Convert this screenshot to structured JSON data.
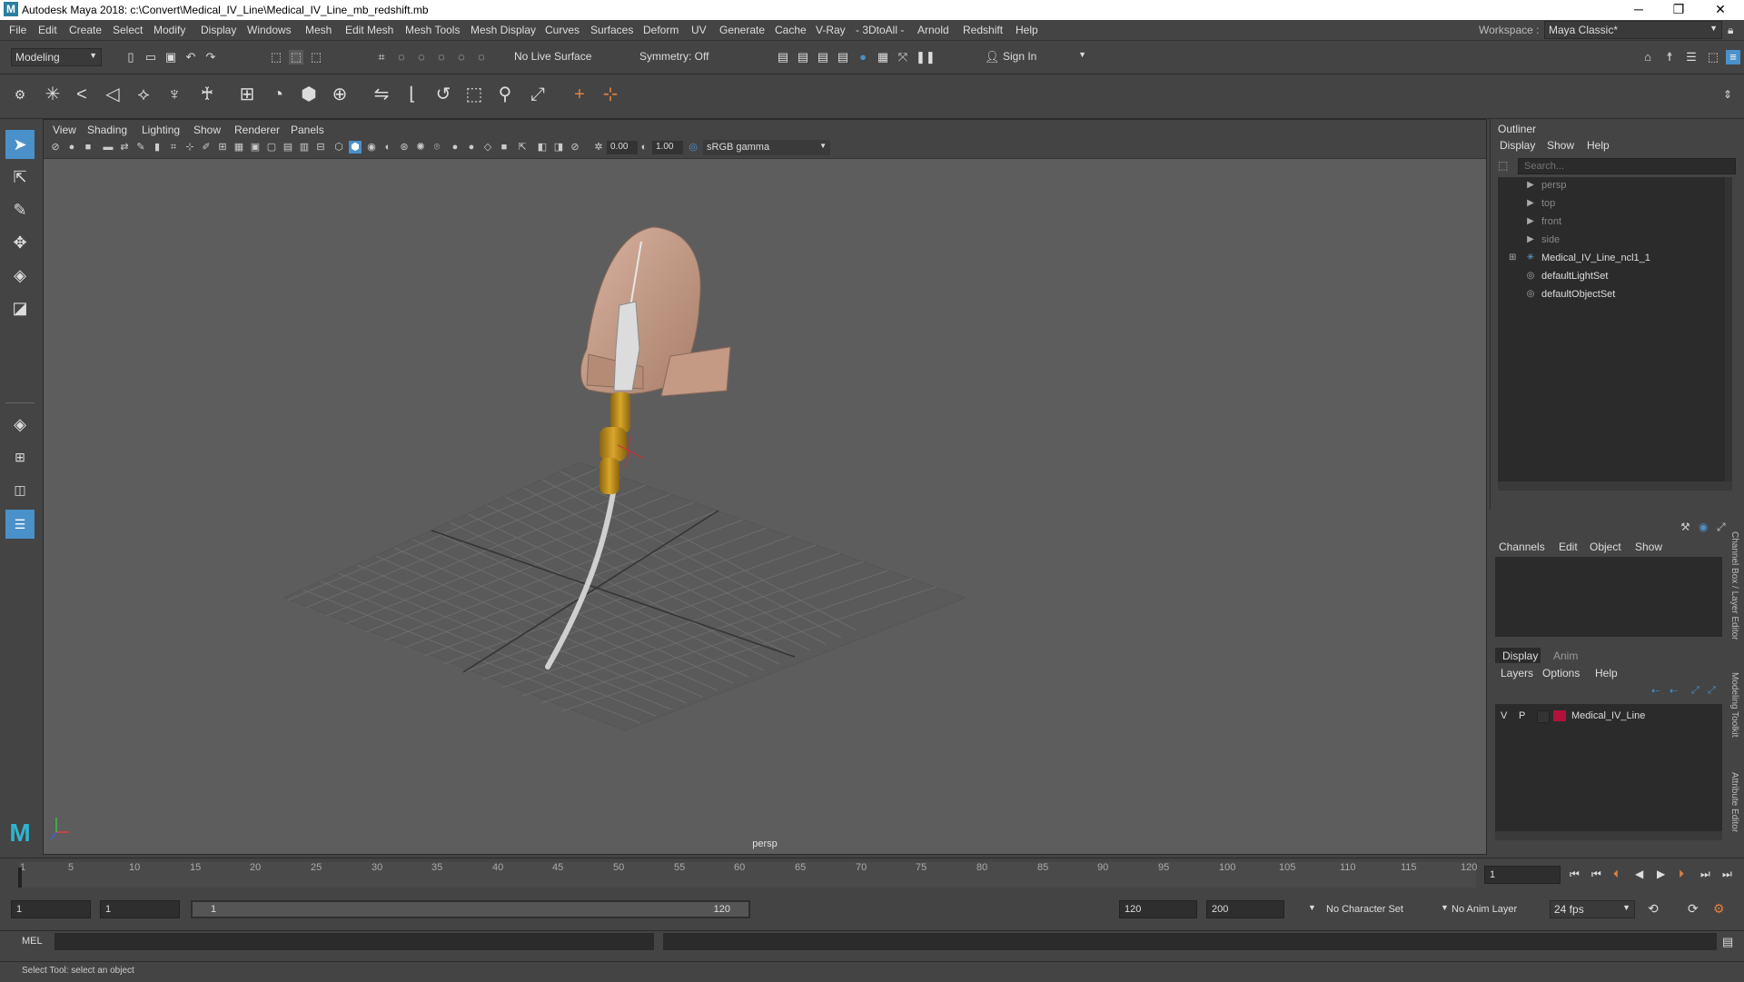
{
  "window": {
    "title": "Autodesk Maya 2018: c:\\Convert\\Medical_IV_Line\\Medical_IV_Line_mb_redshift.mb",
    "minimize": "─",
    "maximize": "❐",
    "close": "✕"
  },
  "menubar": {
    "items": [
      "File",
      "Edit",
      "Create",
      "Select",
      "Modify",
      "Display",
      "Windows",
      "Mesh",
      "Edit Mesh",
      "Mesh Tools",
      "Mesh Display",
      "Curves",
      "Surfaces",
      "Deform",
      "UV",
      "Generate",
      "Cache",
      "V-Ray",
      "- 3DtoAll -",
      "Arnold",
      "Redshift",
      "Help"
    ],
    "workspace_label": "Workspace :",
    "workspace_value": "Maya Classic*"
  },
  "statusline": {
    "mode": "Modeling",
    "live_surface": "No Live Surface",
    "symmetry": "Symmetry: Off",
    "sign_in": "Sign In"
  },
  "viewport": {
    "menus": [
      "View",
      "Shading",
      "Lighting",
      "Show",
      "Renderer",
      "Panels"
    ],
    "exposure": "0.00",
    "gamma": "1.00",
    "color_space": "sRGB gamma",
    "camera_label": "persp"
  },
  "outliner": {
    "title": "Outliner",
    "menus": [
      "Display",
      "Show",
      "Help"
    ],
    "search_placeholder": "Search...",
    "items": [
      {
        "label": "persp",
        "icon": "camera-icon",
        "dim": true
      },
      {
        "label": "top",
        "icon": "camera-icon",
        "dim": true
      },
      {
        "label": "front",
        "icon": "camera-icon",
        "dim": true
      },
      {
        "label": "side",
        "icon": "camera-icon",
        "dim": true
      },
      {
        "label": "Medical_IV_Line_ncl1_1",
        "icon": "group-icon",
        "dim": false
      },
      {
        "label": "defaultLightSet",
        "icon": "set-icon",
        "dim": false
      },
      {
        "label": "defaultObjectSet",
        "icon": "set-icon",
        "dim": false
      }
    ]
  },
  "channelbox": {
    "menus": [
      "Channels",
      "Edit",
      "Object",
      "Show"
    ]
  },
  "layers": {
    "tabs": [
      "Display",
      "Anim"
    ],
    "menus": [
      "Layers",
      "Options",
      "Help"
    ],
    "layer": {
      "v": "V",
      "p": "P",
      "name": "Medical_IV_Line",
      "color": "#b0123a"
    }
  },
  "side_tabs": [
    "Channel Box / Layer Editor",
    "Modeling Toolkit",
    "Attribute Editor"
  ],
  "timeline": {
    "ticks": [
      "1",
      "5",
      "10",
      "15",
      "20",
      "25",
      "30",
      "35",
      "40",
      "45",
      "50",
      "55",
      "60",
      "65",
      "70",
      "75",
      "80",
      "85",
      "90",
      "95",
      "100",
      "105",
      "110",
      "115",
      "120"
    ],
    "current_frame": "1"
  },
  "range": {
    "start": "1",
    "anim_start": "1",
    "slider_start": "1",
    "slider_end": "120",
    "anim_end": "120",
    "end": "200",
    "character_set": "No Character Set",
    "anim_layer": "No Anim Layer",
    "fps": "24 fps"
  },
  "command": {
    "label": "MEL"
  },
  "help_line": "Select Tool: select an object",
  "colors": {
    "accent": "#4a90c9",
    "skin": "#c9a08a",
    "connector": "#c8961a",
    "tube": "#cfcfcf"
  }
}
